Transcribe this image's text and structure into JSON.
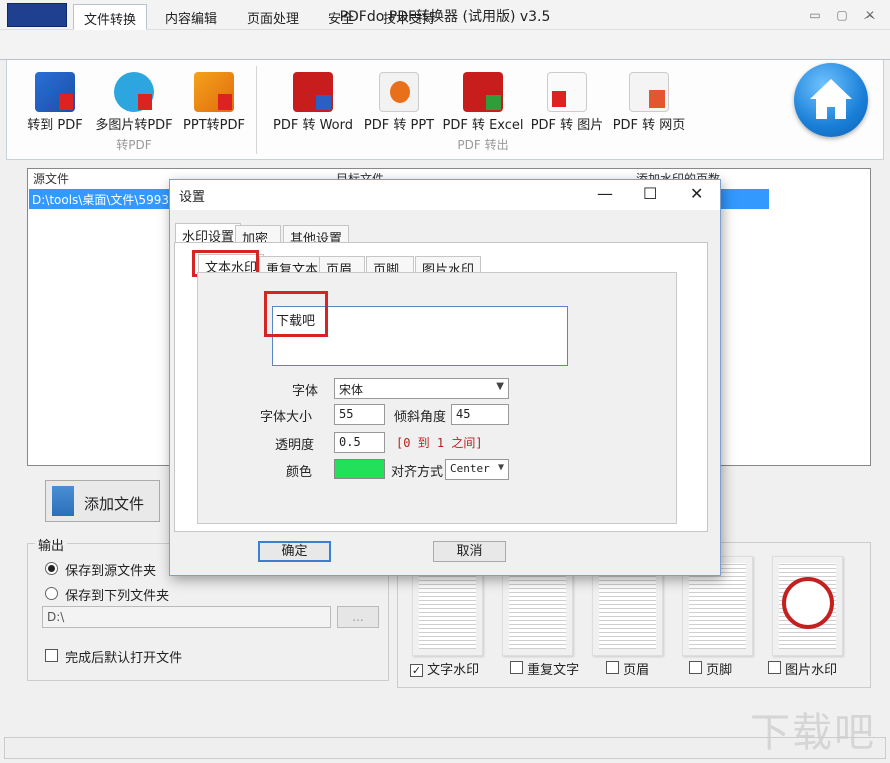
{
  "app": {
    "title": "PDFdo  PDF转换器 (试用版) v3.5"
  },
  "menu_tabs": [
    "文件转换",
    "内容编辑",
    "页面处理",
    "安全",
    "技术支持"
  ],
  "ribbon": {
    "to_pdf_buttons": [
      "转到 PDF",
      "多图片转PDF",
      "PPT转PDF"
    ],
    "to_pdf_group": "转PDF",
    "pdf_out_buttons": [
      "PDF 转 Word",
      "PDF 转 PPT",
      "PDF 转 Excel",
      "PDF 转 图片",
      "PDF 转 网页"
    ],
    "pdf_out_group": "PDF 转出"
  },
  "file_list": {
    "columns": [
      "源文件",
      "目标文件",
      "添加水印的页数"
    ],
    "rows": [
      {
        "source": "D:\\tools\\桌面\\文件\\5993e"
      }
    ]
  },
  "add_file_label": "添加文件",
  "output": {
    "label": "输出",
    "option_source": "保存到源文件夹",
    "option_folder": "保存到下列文件夹",
    "path": "D:\\",
    "browse": "...",
    "open_after": "完成后默认打开文件"
  },
  "preview": {
    "labels": [
      "文字水印",
      "重复文字",
      "页眉",
      "页脚",
      "图片水印"
    ],
    "checked": [
      true,
      false,
      false,
      false,
      false
    ]
  },
  "dialog": {
    "title": "设置",
    "tabs": [
      "水印设置",
      "加密",
      "其他设置"
    ],
    "sub_tabs": [
      "文本水印",
      "重复文本",
      "页眉",
      "页脚",
      "图片水印"
    ],
    "watermark_text": "下载吧",
    "font_label": "字体",
    "font_value": "宋体",
    "size_label": "字体大小",
    "size_value": "55",
    "angle_label": "倾斜角度",
    "angle_value": "45",
    "opacity_label": "透明度",
    "opacity_value": "0.5",
    "opacity_hint": "[0 到 1 之间]",
    "color_label": "颜色",
    "color_value": "#22e05a",
    "align_label": "对齐方式",
    "align_value": "Center",
    "ok": "确定",
    "cancel": "取消"
  },
  "brand_watermark": "下载吧"
}
